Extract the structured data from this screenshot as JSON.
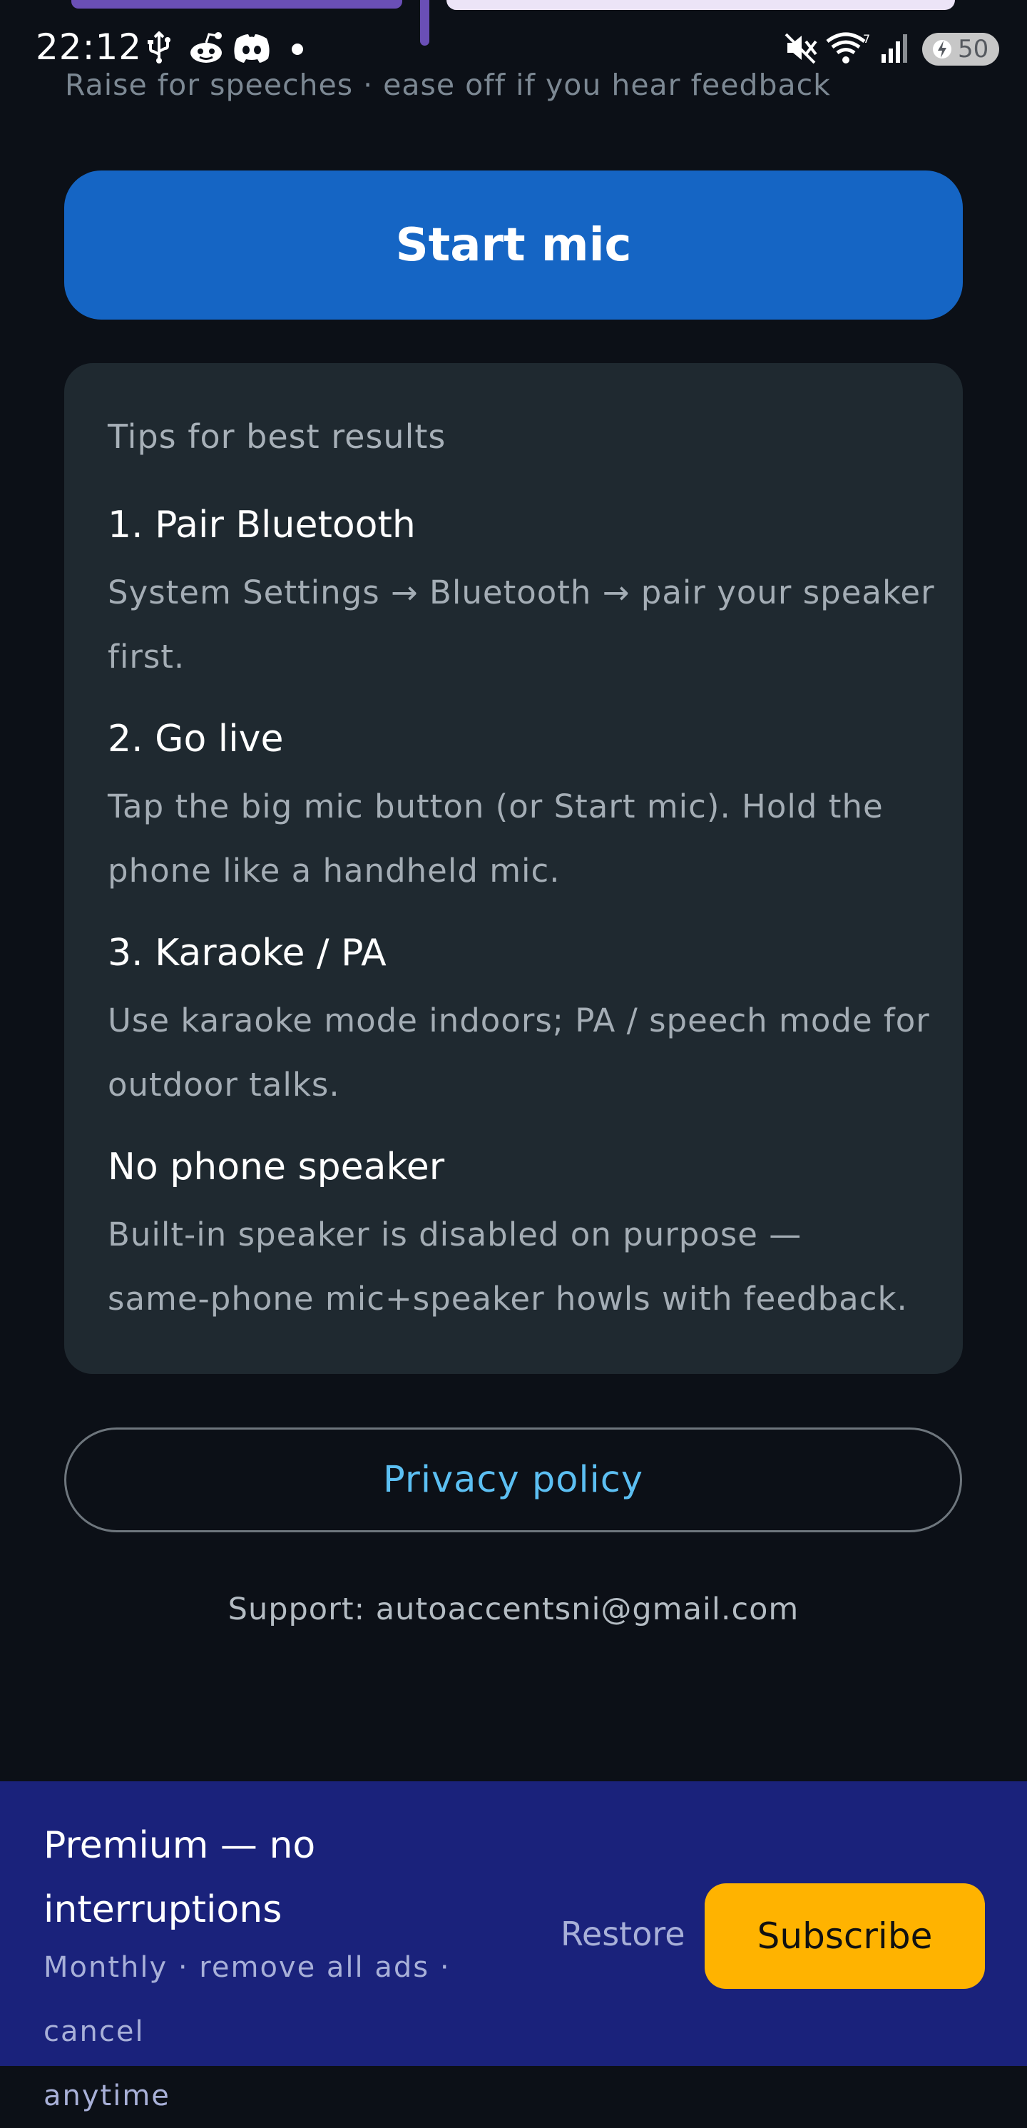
{
  "status_bar": {
    "time": "22:12",
    "battery_level": "50",
    "left_icons": [
      "usb-icon",
      "reddit-icon",
      "discord-icon",
      "notification-dot-icon"
    ],
    "right_icons": [
      "mute-icon",
      "wifi-icon",
      "signal-icon",
      "battery-charging-icon"
    ]
  },
  "volume": {
    "hint": "Raise for speeches · ease off if you hear feedback"
  },
  "controls": {
    "start_mic_label": "Start mic"
  },
  "tips": {
    "heading": "Tips for best results",
    "items": [
      {
        "title": "1. Pair Bluetooth",
        "body_line1": "System Settings → Bluetooth → pair your speaker",
        "body_line2": "first."
      },
      {
        "title": "2. Go live",
        "body_line1": "Tap the big mic button (or Start mic). Hold the",
        "body_line2": "phone like a handheld mic."
      },
      {
        "title": "3. Karaoke / PA",
        "body_line1": "Use karaoke mode indoors; PA / speech mode for",
        "body_line2": "outdoor talks."
      },
      {
        "title": "No phone speaker",
        "body_line1": "Built-in speaker is disabled on purpose —",
        "body_line2": "same-phone mic+speaker howls with feedback."
      }
    ]
  },
  "links": {
    "privacy_label": "Privacy policy",
    "support_text": "Support: autoaccentsni@gmail.com"
  },
  "premium": {
    "title_line1": "Premium — no",
    "title_line2": "interruptions",
    "subtitle_line1": "Monthly · remove all ads · cancel",
    "subtitle_line2": "anytime",
    "restore_label": "Restore",
    "subscribe_label": "Subscribe"
  },
  "colors": {
    "background": "#0c1017",
    "primary_button": "#1565c4",
    "card": "#1f2930",
    "link": "#5cbff2",
    "banner": "#1a227b",
    "subscribe": "#ffb300"
  }
}
